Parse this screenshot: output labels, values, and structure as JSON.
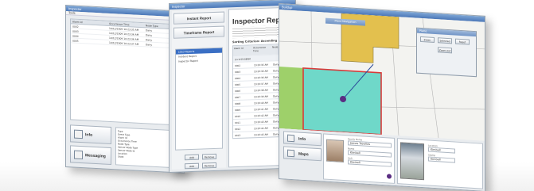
{
  "window1": {
    "title": "Inspector",
    "menu": "Tools",
    "columns": [
      "Alarm Id",
      "Occurrence Time",
      "Node Type"
    ],
    "rows": [
      [
        "0002",
        "10/12/2009 10:23:35 AM",
        "Dairy"
      ],
      [
        "0003",
        "10/12/2009 10:23:36 AM",
        "Dairy"
      ],
      [
        "0004",
        "10/12/2009 10:23:36 AM",
        "Dairy"
      ],
      [
        "0005",
        "10/12/2009 10:23:37 AM",
        "Dairy"
      ]
    ],
    "info_button": "Info",
    "messaging_button": "Messaging",
    "detail": [
      "Type",
      "Event Type",
      "Alarm Id",
      "Occurrence Time",
      "Node Type",
      "Sensor Node Type",
      "Sensor Node Id",
      "Location",
      "State"
    ]
  },
  "window2": {
    "title": "Inspector",
    "instant_report": "Instant Report",
    "timeframe_report": "Timeframe Report",
    "tree": [
      "LOLO Reports",
      "Incident Report",
      "Inspector Report"
    ],
    "add_button": "Add",
    "remove_button": "Remove",
    "add_button2": "Add",
    "remove_button2": "Remove",
    "doc_title": "Inspector Report",
    "doc_section": "Sorting Criterion: Ascending",
    "doc_columns": [
      "Alarm Id",
      "Occurrence Time",
      "Node Type"
    ],
    "doc_group": "Lis 9:59:58AM",
    "doc_rows": [
      [
        "0002",
        "10:23:35 AM",
        "Dairy"
      ],
      [
        "0003",
        "10:23:36 AM",
        "Dairy"
      ],
      [
        "0004",
        "10:23:36 AM",
        "Dairy"
      ],
      [
        "0005",
        "10:23:37 AM",
        "Dairy"
      ],
      [
        "0006",
        "10:23:38 AM",
        "Dairy"
      ],
      [
        "0007",
        "10:23:39 AM",
        "Dairy"
      ],
      [
        "0008",
        "10:23:40 AM",
        "Dairy"
      ],
      [
        "0009",
        "10:23:41 AM",
        "Dairy"
      ],
      [
        "0010",
        "10:23:42 AM",
        "Dairy"
      ],
      [
        "0011",
        "10:23:43 AM",
        "Dairy"
      ],
      [
        "0012",
        "10:23:44 AM",
        "Dairy"
      ],
      [
        "0013",
        "10:23:45 AM",
        "Dairy"
      ]
    ]
  },
  "window3": {
    "title": "Buildup",
    "menu": "Tools",
    "nav_title": "Plane Navigation",
    "popup_title": "Plane",
    "popup_buttons": [
      "Zoom",
      "Selected",
      "Reset",
      "Zoom out"
    ],
    "info_button": "Info",
    "map_button": "Maps",
    "person_labels": [
      "Family Name",
      "Name",
      "Unit"
    ],
    "person_values": [
      "James Trevillas",
      "Kimball",
      "Kimball"
    ],
    "camera_labels": [
      "Location",
      "Stamp"
    ],
    "camera_values": [
      "Kimball",
      "Kimball"
    ],
    "colors": {
      "yellow_zone": "#e3c04e",
      "cyan_zone": "#6fd8c9",
      "green_zone": "#9ed06a",
      "red_border": "#d93a3a",
      "pin": "#5a2d82"
    }
  }
}
